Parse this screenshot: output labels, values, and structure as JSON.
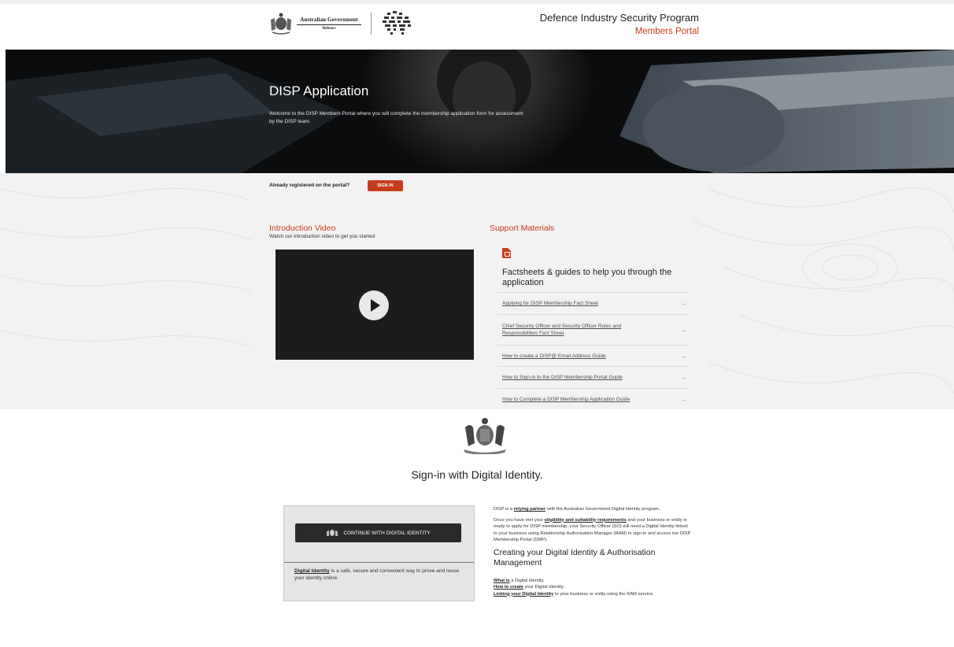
{
  "header": {
    "gov_line1": "Australian Government",
    "gov_line2": "Defence",
    "program_title": "Defence Industry Security Program",
    "portal_name": "Members Portal"
  },
  "hero": {
    "title": "DISP Application",
    "description": "Welcome to the DISP Members Portal where you will complete the membership application form for assessment by the DISP team."
  },
  "signin": {
    "prompt": "Already registered on the portal?",
    "button_label": "SIGN IN"
  },
  "intro": {
    "heading": "Introduction Video",
    "subtitle": "Watch our introduction video to get you started"
  },
  "support": {
    "heading": "Support Materials",
    "factsheet_heading": "Factsheets & guides to help you through the application",
    "links": [
      {
        "label": "Applying for DISP Membership Fact Sheet"
      },
      {
        "label": "Chief Security Officer and Security Officer Roles and Responsibilities Fact Sheet"
      },
      {
        "label": "How to create a DISP@ Email Address Guide"
      },
      {
        "label": "How to Sign-in to the DISP Membership Portal Guide"
      },
      {
        "label": "How to Complete a DISP Membership Application Guide"
      }
    ]
  },
  "digital_identity": {
    "title": "Sign-in with Digital Identity.",
    "button_label": "CONTINUE WITH DIGITAL IDENTITY",
    "blurb_link": "Digital Identity",
    "blurb_text": " is a safe, secure and convenient way to prove and reuse your identity online.",
    "p1_a": "DISP is a ",
    "p1_link": "relying partner",
    "p1_b": " with the Australian Government Digital Identity program.",
    "p2_a": "Once you have met your ",
    "p2_link": "eligibility and suitability requirements",
    "p2_b": " and your business or entity is ready to apply for DISP membership, your Security Officer (SO) will need a Digital Identity linked to your business using Relationship Authorisation Manager (RAM) to sign-in and access our DISP Membership Portal (DMP).",
    "subheading": "Creating your Digital Identity & Authorisation Management",
    "items": [
      {
        "link": "What is",
        "text": " a Digital Identity."
      },
      {
        "link": "How to create",
        "text": " your Digital Identity."
      },
      {
        "link": "Linking your Digital Identity",
        "text": " to your business or entity using the RAM service."
      }
    ]
  },
  "colors": {
    "accent": "#c63d1d",
    "hero_bg": "#0b0c0e",
    "section_bg": "#f2f2f2",
    "card_bg": "#e5e5e5",
    "button_dark": "#2a2a2a"
  }
}
